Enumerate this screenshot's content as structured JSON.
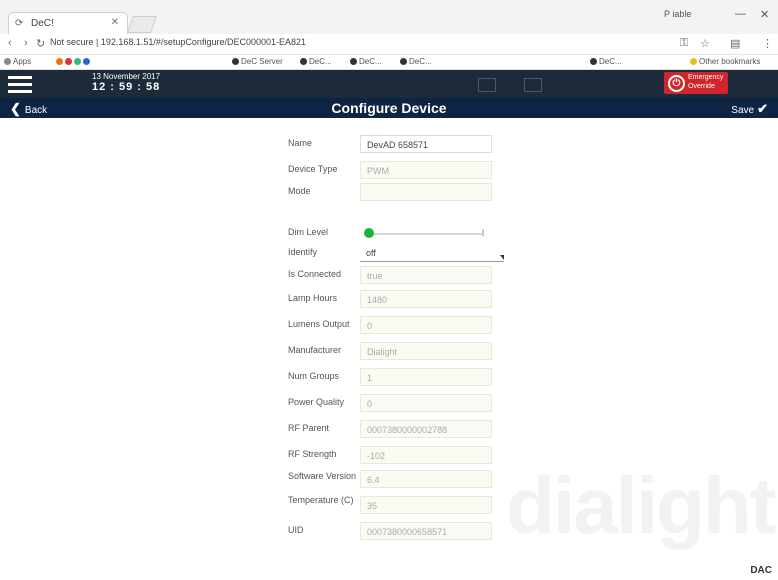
{
  "browser": {
    "tab_title": "DeC!",
    "user": "P iable",
    "address": "Not secure | 192.168.1.51/#/setupConfigure/DEC000001-EA821",
    "bookmarks": [
      "Apps",
      "DeC Server",
      "DeC...",
      "DeC...",
      "DeC...",
      "DeC...",
      "Other bookmarks"
    ]
  },
  "header": {
    "date": "13 November 2017",
    "time": "12 : 59 : 58",
    "emergency_line1": "Emergency",
    "emergency_line2": "Override"
  },
  "titlebar": {
    "back_label": "Back",
    "title": "Configure Device",
    "save_label": "Save"
  },
  "form": {
    "name": {
      "label": "Name",
      "value": "DevAD 658571"
    },
    "device_type": {
      "label": "Device Type",
      "value": "PWM"
    },
    "mode": {
      "label": "Mode",
      "value": ""
    },
    "dim_level": {
      "label": "Dim Level",
      "value": 0
    },
    "identify": {
      "label": "Identify",
      "value": "off"
    },
    "connected": {
      "label": "Is Connected",
      "value": "true"
    },
    "lamp_hours": {
      "label": "Lamp Hours",
      "value": "1480"
    },
    "lumens_output": {
      "label": "Lumens Output",
      "value": "0"
    },
    "manufacturer": {
      "label": "Manufacturer",
      "value": "Dialight"
    },
    "num_groups": {
      "label": "Num Groups",
      "value": "1"
    },
    "power_quality": {
      "label": "Power Quality",
      "value": "0"
    },
    "rf_parent": {
      "label": "RF Parent",
      "value": "0007380000002788"
    },
    "rf_strength": {
      "label": "RF Strength",
      "value": "-102"
    },
    "software_version": {
      "label": "Software Version",
      "value": "6.4"
    },
    "temperature": {
      "label": "Temperature (C)",
      "value": "35"
    },
    "uid": {
      "label": "UID",
      "value": "0007380000658571"
    }
  },
  "footer": {
    "watermark": "dialight",
    "brand": "DAC"
  },
  "colors": {
    "header": "#1d2a3a",
    "titlebar": "#0d2442",
    "emergency": "#d0262b",
    "slider": "#1bb33a"
  }
}
